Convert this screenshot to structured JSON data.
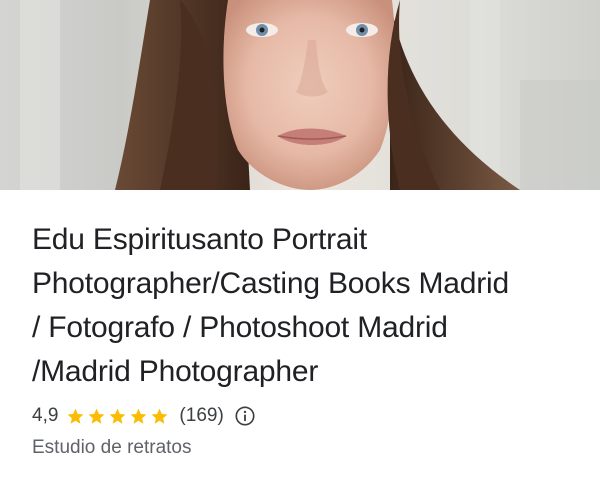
{
  "place": {
    "title_lines": [
      "Edu Espiritusanto Portrait",
      "Photographer/Casting Books Madrid",
      "/ Fotografo / Photoshoot Madrid",
      "/Madrid Photographer"
    ],
    "rating": "4,9",
    "rating_fraction": 0.98,
    "stars_filled": 5,
    "review_count": "(169)",
    "category": "Estudio de retratos"
  },
  "colors": {
    "star": "#fbbc04",
    "title": "#202124",
    "secondary": "#5f6368"
  },
  "icons": {
    "info": "info-circle-icon",
    "star": "star-icon"
  }
}
